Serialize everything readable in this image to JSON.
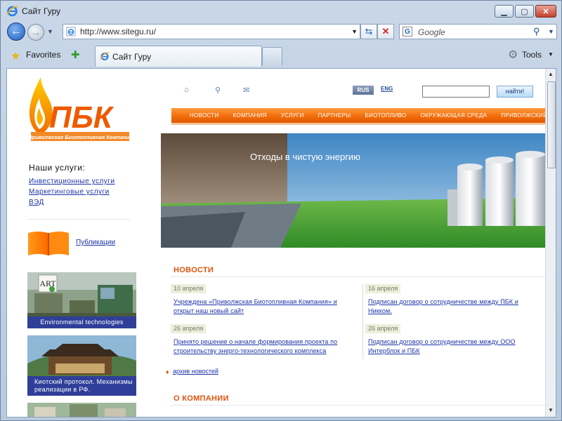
{
  "window": {
    "title": "Сайт Гуру"
  },
  "navbar": {
    "address": "http://www.sitegu.ru/",
    "search_placeholder": "Google"
  },
  "cmdbar": {
    "favorites_label": "Favorites",
    "tab_title": "Сайт Гуру",
    "tools_label": "Tools"
  },
  "page": {
    "logo_text": "ПБК",
    "logo_subtitle": "«Приволжская Биотопливная Компания»",
    "services_title": "Наши услуги:",
    "services": [
      "Инвестиционные услуги",
      "Маркетинговые услуги",
      "ВЭД"
    ],
    "publications_link": "Публикации",
    "banners": [
      {
        "badge": "ART",
        "caption": "Environmental technologies"
      },
      {
        "caption": "Киотский протокол. Механизмы реализации в РФ."
      }
    ],
    "lang_rus": "RUS",
    "lang_eng": "ENG",
    "search_button": "найти!",
    "menu": [
      "НОВОСТИ",
      "КОМПАНИЯ",
      "УСЛУГИ",
      "ПАРТНЕРЫ",
      "БИОТОПЛИВО",
      "ОКРУЖАЮЩАЯ СРЕДА",
      "ПРИВОЛЖСКИЙ ФО"
    ],
    "hero_text": "Отходы в чистую энергию",
    "news_title": "НОВОСТИ",
    "news": [
      {
        "date": "10 апреля",
        "text": "Учреждена «Приволжская Биотопливная Компания» и открыт наш новый сайт"
      },
      {
        "date": "16 апреля",
        "text": "Подписан договор о сотрудничестве между ПБК и Никком."
      },
      {
        "date": "26 апреля",
        "text": "Принято решение о начале формирования проекта по строительству энерго-технологического комплекса"
      },
      {
        "date": "26 апреля",
        "text": "Подписан договор о сотрудничестве между ООО Интерблок и ПБК"
      }
    ],
    "archive_link": "архив новостей",
    "company_title": "О КОМПАНИИ"
  },
  "colors": {
    "accent_orange": "#f16a08",
    "link_blue": "#1c33a6",
    "banner_blue": "#2f3f99"
  }
}
